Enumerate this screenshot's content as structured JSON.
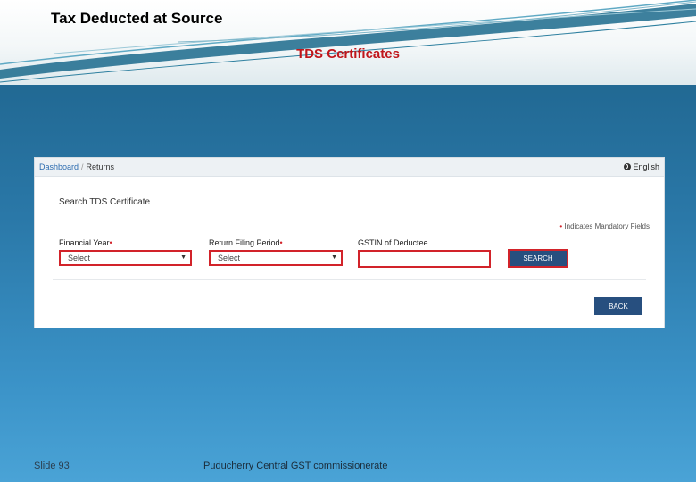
{
  "slide": {
    "title": "Tax Deducted at Source",
    "subtitle": "TDS Certificates",
    "footer_left": "Slide 93",
    "footer_center": "Puducherry Central GST commissionerate"
  },
  "portal": {
    "breadcrumb": {
      "dashboard": "Dashboard",
      "separator": "/",
      "current": "Returns"
    },
    "language": "English",
    "heading": "Search TDS Certificate",
    "mandatory_note": "Indicates Mandatory Fields",
    "required_marker": "•",
    "fields": {
      "financial_year": {
        "label": "Financial Year",
        "value": "Select"
      },
      "return_period": {
        "label": "Return Filing Period",
        "value": "Select"
      },
      "gstin": {
        "label": "GSTIN of Deductee",
        "value": ""
      }
    },
    "caret": "▼",
    "search_label": "SEARCH",
    "back_label": "BACK"
  },
  "colors": {
    "accent_red": "#d2232a",
    "button_blue": "#274f7f",
    "subtitle_red": "#c0161b"
  }
}
